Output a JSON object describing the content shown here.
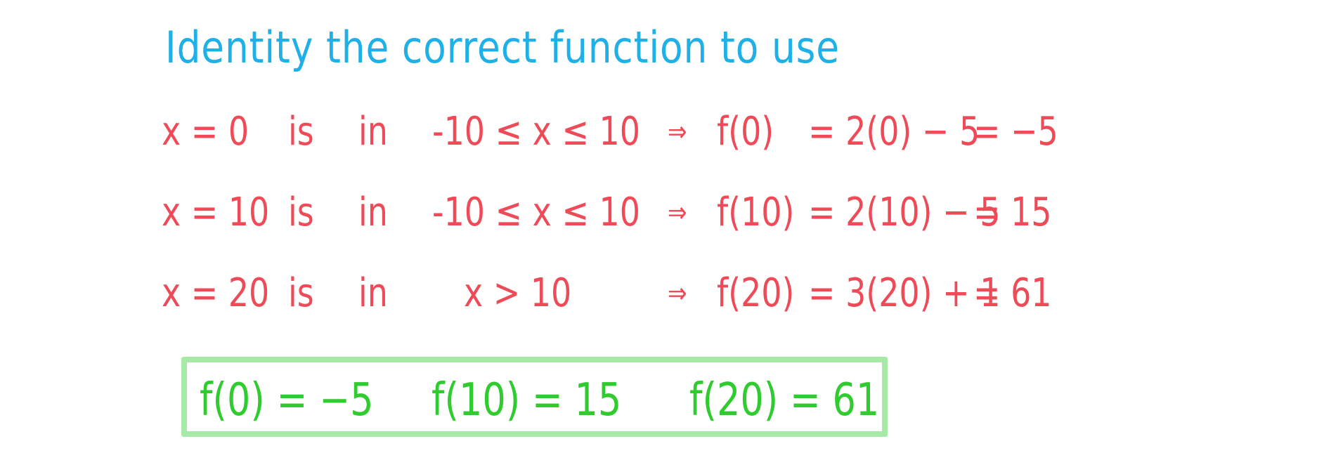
{
  "title": "Identity the correct function to use",
  "colors": {
    "title": "#1fb0e8",
    "working": "#ee4a57",
    "answer_text": "#2fcb2f",
    "answer_border": "#a7e9a7"
  },
  "rows": [
    {
      "x": "x = 0",
      "is": "is",
      "in": "in",
      "condition": "-10 ≤ x ≤ 10",
      "arrow": "⇒",
      "fx": "f(0)",
      "expression": "= 2(0) − 5",
      "result": "= −5"
    },
    {
      "x": "x = 10",
      "is": "is",
      "in": "in",
      "condition": "-10 ≤ x ≤ 10",
      "arrow": "⇒",
      "fx": "f(10)",
      "expression": "= 2(10) − 5",
      "result": "= 15"
    },
    {
      "x": "x = 20",
      "is": "is",
      "in": "in",
      "condition": "x > 10",
      "arrow": "⇒",
      "fx": "f(20)",
      "expression": "= 3(20) + 1",
      "result": "= 61"
    }
  ],
  "answers": [
    "f(0) = −5",
    "f(10) = 15",
    "f(20) = 61"
  ]
}
